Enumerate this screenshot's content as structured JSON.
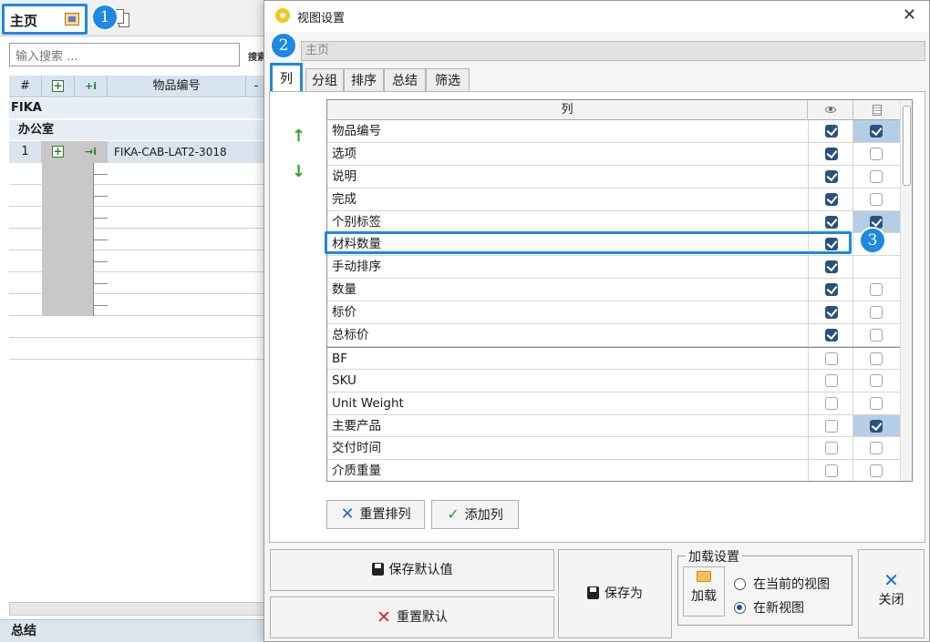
{
  "main_window": {
    "home_tab_label": "主页",
    "search_placeholder": "输入搜索 ...",
    "search_trailing_text": "搜索",
    "grid_headers": {
      "index": "#",
      "item_number": "物品编号",
      "dash": "-"
    },
    "group_brand": "FIKA",
    "group_room": "办公室",
    "row1": {
      "index": "1",
      "item_number": "FIKA-CAB-LAT2-3018"
    },
    "total_label": "总结"
  },
  "annotations": {
    "badge1": "1",
    "badge2": "2",
    "badge3": "3",
    "accent_color": "#1e88e5"
  },
  "dialog": {
    "title": "视图设置",
    "close_glyph": "✕",
    "view_name": "主页",
    "tabs": [
      "列",
      "分组",
      "排序",
      "总结",
      "筛选"
    ],
    "column_header": "列",
    "rows": [
      {
        "name": "物品编号",
        "visible": true,
        "sort": true,
        "sort_selected": true
      },
      {
        "name": "选项",
        "visible": true,
        "sort": false
      },
      {
        "name": "说明",
        "visible": true,
        "sort": false
      },
      {
        "name": "完成",
        "visible": true,
        "sort": false
      },
      {
        "name": "个别标签",
        "visible": true,
        "sort": true,
        "sort_selected": true
      },
      {
        "name": "材料数量",
        "visible": true,
        "sort": null
      },
      {
        "name": "手动排序",
        "visible": true,
        "sort": null
      },
      {
        "name": "数量",
        "visible": true,
        "sort": false
      },
      {
        "name": "标价",
        "visible": true,
        "sort": false
      },
      {
        "name": "总标价",
        "visible": true,
        "sort": false
      },
      {
        "name": "BF",
        "visible": false,
        "sort": false
      },
      {
        "name": "SKU",
        "visible": false,
        "sort": false
      },
      {
        "name": "Unit Weight",
        "visible": false,
        "sort": false
      },
      {
        "name": "主要产品",
        "visible": false,
        "sort": true,
        "sort_selected": true
      },
      {
        "name": "交付时间",
        "visible": false,
        "sort": false
      },
      {
        "name": "介质重量",
        "visible": false,
        "sort": false
      }
    ],
    "buttons": {
      "reset_columns": "重置排列",
      "add_column": "添加列",
      "save_default": "保存默认值",
      "reset_default": "重置默认",
      "save_as": "保存为",
      "close": "关闭"
    },
    "load_settings": {
      "legend": "加载设置",
      "load_button": "加载",
      "option_current": "在当前的视图",
      "option_new": "在新视图",
      "selected": "option_new"
    }
  }
}
